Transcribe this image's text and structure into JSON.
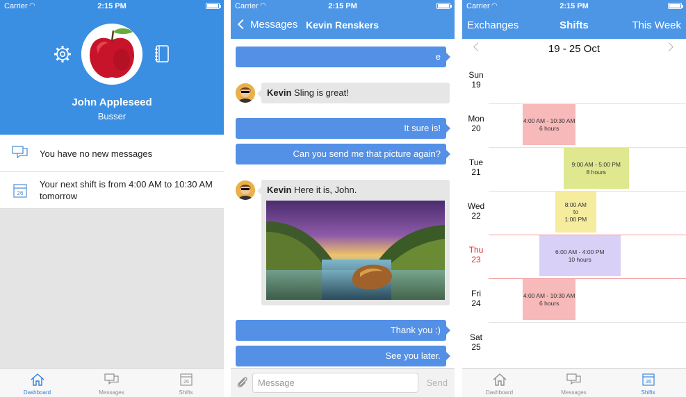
{
  "status_bar": {
    "carrier": "Carrier",
    "time": "2:15 PM"
  },
  "colors": {
    "header_blue": "#3a8fe3",
    "nav_blue": "#4d96e6",
    "outgoing_bubble": "#5390e6",
    "incoming_bubble": "#e6e6e6",
    "shift_pink": "#f7b9b9",
    "shift_green": "#dfe88f",
    "shift_yellow": "#f6ec9e",
    "shift_lavender": "#d9d0f7",
    "today_red": "#e3262a"
  },
  "dashboard": {
    "name": "John Appleseed",
    "role": "Busser",
    "rows": [
      {
        "icon": "chat-bubbles-icon",
        "text": "You have no new messages"
      },
      {
        "icon": "calendar-icon",
        "text": "Your next shift is from 4:00 AM to 10:30 AM tomorrow",
        "calendar_day": "26"
      }
    ]
  },
  "tabbar": {
    "tabs": [
      {
        "icon": "home-icon",
        "label": "Dashboard"
      },
      {
        "icon": "messages-icon",
        "label": "Messages"
      },
      {
        "icon": "calendar-icon",
        "label": "Shifts",
        "day": "26"
      }
    ]
  },
  "messages": {
    "back_label": "Messages",
    "title": "Kevin Renskers",
    "items": [
      {
        "dir": "out",
        "text": "e"
      },
      {
        "dir": "in",
        "sender": "Kevin",
        "text": "Sling is great!"
      },
      {
        "dir": "out",
        "text": "It sure is!"
      },
      {
        "dir": "out",
        "text": "Can you send me that picture again?"
      },
      {
        "dir": "in",
        "sender": "Kevin",
        "text": "Here it is, John.",
        "has_photo": true
      },
      {
        "dir": "out",
        "text": "Thank you :)"
      },
      {
        "dir": "out",
        "text": "See you later."
      }
    ],
    "input_placeholder": "Message",
    "send_label": "Send"
  },
  "shifts": {
    "left_label": "Exchanges",
    "title": "Shifts",
    "right_label": "This Week",
    "range": "19 - 25 Oct",
    "days": [
      {
        "name": "Sun",
        "num": "19",
        "today": false
      },
      {
        "name": "Mon",
        "num": "20",
        "today": false
      },
      {
        "name": "Tue",
        "num": "21",
        "today": false
      },
      {
        "name": "Wed",
        "num": "22",
        "today": false
      },
      {
        "name": "Thu",
        "num": "23",
        "today": true
      },
      {
        "name": "Fri",
        "num": "24",
        "today": false
      },
      {
        "name": "Sat",
        "num": "25",
        "today": false
      }
    ],
    "blocks": [
      {
        "day": 1,
        "lines": [
          "4:00 AM - 10:30 AM",
          "6 hours"
        ],
        "start": "4:00 AM",
        "end": "10:30 AM",
        "color": "#f7b9b9"
      },
      {
        "day": 2,
        "lines": [
          "9:00 AM - 5:00 PM",
          "8 hours"
        ],
        "start": "9:00 AM",
        "end": "5:00 PM",
        "color": "#dfe88f"
      },
      {
        "day": 3,
        "lines": [
          "8:00 AM",
          "to",
          "1:00 PM"
        ],
        "start": "8:00 AM",
        "end": "1:00 PM",
        "color": "#f6ec9e"
      },
      {
        "day": 4,
        "lines": [
          "6:00 AM - 4:00 PM",
          "10 hours"
        ],
        "start": "6:00 AM",
        "end": "4:00 PM",
        "color": "#d9d0f7"
      },
      {
        "day": 5,
        "lines": [
          "4:00 AM - 10:30 AM",
          "6 hours"
        ],
        "start": "4:00 AM",
        "end": "10:30 AM",
        "color": "#f7b9b9"
      }
    ]
  }
}
